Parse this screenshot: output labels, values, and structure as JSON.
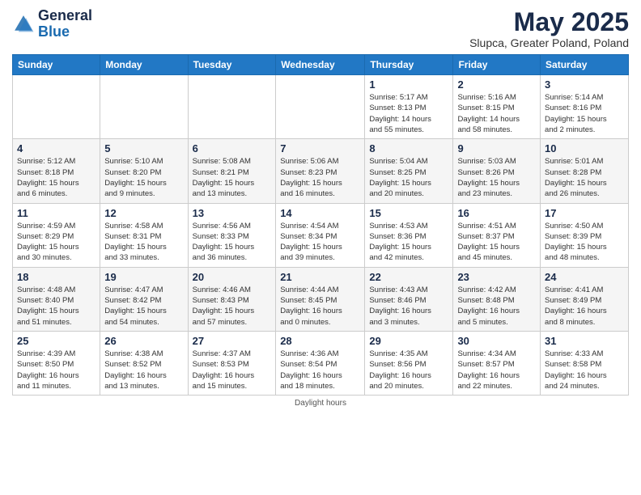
{
  "header": {
    "logo_general": "General",
    "logo_blue": "Blue",
    "month_title": "May 2025",
    "subtitle": "Slupca, Greater Poland, Poland"
  },
  "weekdays": [
    "Sunday",
    "Monday",
    "Tuesday",
    "Wednesday",
    "Thursday",
    "Friday",
    "Saturday"
  ],
  "footer_text": "Daylight hours",
  "weeks": [
    [
      {
        "day": "",
        "info": ""
      },
      {
        "day": "",
        "info": ""
      },
      {
        "day": "",
        "info": ""
      },
      {
        "day": "",
        "info": ""
      },
      {
        "day": "1",
        "info": "Sunrise: 5:17 AM\nSunset: 8:13 PM\nDaylight: 14 hours\nand 55 minutes."
      },
      {
        "day": "2",
        "info": "Sunrise: 5:16 AM\nSunset: 8:15 PM\nDaylight: 14 hours\nand 58 minutes."
      },
      {
        "day": "3",
        "info": "Sunrise: 5:14 AM\nSunset: 8:16 PM\nDaylight: 15 hours\nand 2 minutes."
      }
    ],
    [
      {
        "day": "4",
        "info": "Sunrise: 5:12 AM\nSunset: 8:18 PM\nDaylight: 15 hours\nand 6 minutes."
      },
      {
        "day": "5",
        "info": "Sunrise: 5:10 AM\nSunset: 8:20 PM\nDaylight: 15 hours\nand 9 minutes."
      },
      {
        "day": "6",
        "info": "Sunrise: 5:08 AM\nSunset: 8:21 PM\nDaylight: 15 hours\nand 13 minutes."
      },
      {
        "day": "7",
        "info": "Sunrise: 5:06 AM\nSunset: 8:23 PM\nDaylight: 15 hours\nand 16 minutes."
      },
      {
        "day": "8",
        "info": "Sunrise: 5:04 AM\nSunset: 8:25 PM\nDaylight: 15 hours\nand 20 minutes."
      },
      {
        "day": "9",
        "info": "Sunrise: 5:03 AM\nSunset: 8:26 PM\nDaylight: 15 hours\nand 23 minutes."
      },
      {
        "day": "10",
        "info": "Sunrise: 5:01 AM\nSunset: 8:28 PM\nDaylight: 15 hours\nand 26 minutes."
      }
    ],
    [
      {
        "day": "11",
        "info": "Sunrise: 4:59 AM\nSunset: 8:29 PM\nDaylight: 15 hours\nand 30 minutes."
      },
      {
        "day": "12",
        "info": "Sunrise: 4:58 AM\nSunset: 8:31 PM\nDaylight: 15 hours\nand 33 minutes."
      },
      {
        "day": "13",
        "info": "Sunrise: 4:56 AM\nSunset: 8:33 PM\nDaylight: 15 hours\nand 36 minutes."
      },
      {
        "day": "14",
        "info": "Sunrise: 4:54 AM\nSunset: 8:34 PM\nDaylight: 15 hours\nand 39 minutes."
      },
      {
        "day": "15",
        "info": "Sunrise: 4:53 AM\nSunset: 8:36 PM\nDaylight: 15 hours\nand 42 minutes."
      },
      {
        "day": "16",
        "info": "Sunrise: 4:51 AM\nSunset: 8:37 PM\nDaylight: 15 hours\nand 45 minutes."
      },
      {
        "day": "17",
        "info": "Sunrise: 4:50 AM\nSunset: 8:39 PM\nDaylight: 15 hours\nand 48 minutes."
      }
    ],
    [
      {
        "day": "18",
        "info": "Sunrise: 4:48 AM\nSunset: 8:40 PM\nDaylight: 15 hours\nand 51 minutes."
      },
      {
        "day": "19",
        "info": "Sunrise: 4:47 AM\nSunset: 8:42 PM\nDaylight: 15 hours\nand 54 minutes."
      },
      {
        "day": "20",
        "info": "Sunrise: 4:46 AM\nSunset: 8:43 PM\nDaylight: 15 hours\nand 57 minutes."
      },
      {
        "day": "21",
        "info": "Sunrise: 4:44 AM\nSunset: 8:45 PM\nDaylight: 16 hours\nand 0 minutes."
      },
      {
        "day": "22",
        "info": "Sunrise: 4:43 AM\nSunset: 8:46 PM\nDaylight: 16 hours\nand 3 minutes."
      },
      {
        "day": "23",
        "info": "Sunrise: 4:42 AM\nSunset: 8:48 PM\nDaylight: 16 hours\nand 5 minutes."
      },
      {
        "day": "24",
        "info": "Sunrise: 4:41 AM\nSunset: 8:49 PM\nDaylight: 16 hours\nand 8 minutes."
      }
    ],
    [
      {
        "day": "25",
        "info": "Sunrise: 4:39 AM\nSunset: 8:50 PM\nDaylight: 16 hours\nand 11 minutes."
      },
      {
        "day": "26",
        "info": "Sunrise: 4:38 AM\nSunset: 8:52 PM\nDaylight: 16 hours\nand 13 minutes."
      },
      {
        "day": "27",
        "info": "Sunrise: 4:37 AM\nSunset: 8:53 PM\nDaylight: 16 hours\nand 15 minutes."
      },
      {
        "day": "28",
        "info": "Sunrise: 4:36 AM\nSunset: 8:54 PM\nDaylight: 16 hours\nand 18 minutes."
      },
      {
        "day": "29",
        "info": "Sunrise: 4:35 AM\nSunset: 8:56 PM\nDaylight: 16 hours\nand 20 minutes."
      },
      {
        "day": "30",
        "info": "Sunrise: 4:34 AM\nSunset: 8:57 PM\nDaylight: 16 hours\nand 22 minutes."
      },
      {
        "day": "31",
        "info": "Sunrise: 4:33 AM\nSunset: 8:58 PM\nDaylight: 16 hours\nand 24 minutes."
      }
    ]
  ]
}
